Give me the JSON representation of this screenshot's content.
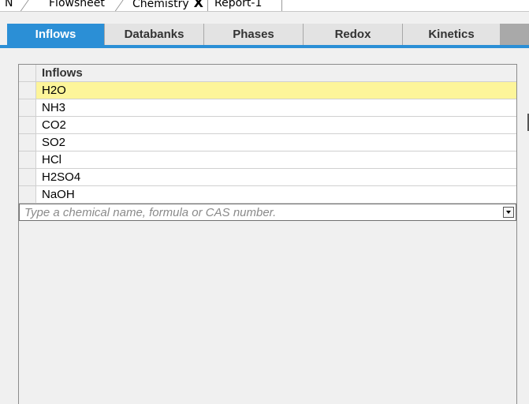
{
  "doc_tabs": [
    {
      "label": "N"
    },
    {
      "label": "Flowsheet"
    },
    {
      "label": "Chemistry"
    },
    {
      "label": "Report-1"
    }
  ],
  "doc_tab_close": "X",
  "sub_tabs": [
    {
      "label": "Inflows"
    },
    {
      "label": "Databanks"
    },
    {
      "label": "Phases"
    },
    {
      "label": "Redox"
    },
    {
      "label": "Kinetics"
    }
  ],
  "grid": {
    "header": "Inflows",
    "rows": [
      "H2O",
      "NH3",
      "CO2",
      "SO2",
      "HCl",
      "H2SO4",
      "NaOH"
    ],
    "entry_placeholder": "Type a chemical name, formula or CAS number."
  }
}
